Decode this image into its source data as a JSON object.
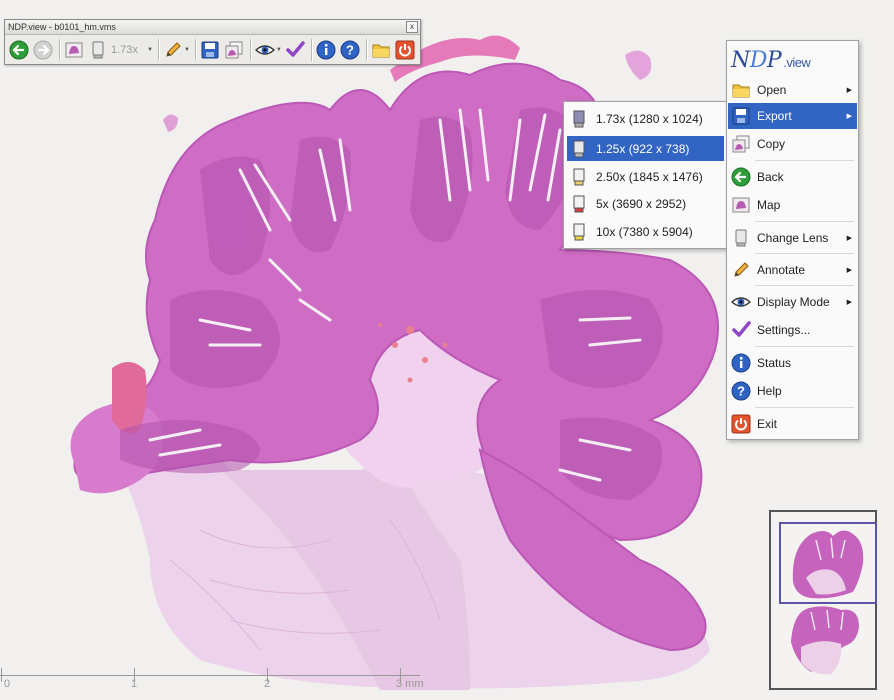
{
  "app": {
    "window_title": "NDP.view - b0101_hm.vms"
  },
  "toolbar": {
    "zoom_label": "1.73x",
    "close_glyph": "x",
    "icons": [
      "back-icon",
      "forward-icon",
      "map-icon",
      "lens-icon",
      "annotate-icon",
      "export-icon",
      "copy-icon",
      "display-mode-icon",
      "settings-icon",
      "status-icon",
      "help-icon",
      "open-icon",
      "exit-icon"
    ]
  },
  "context_menu": {
    "logo": {
      "part1": "N",
      "part2": "D",
      "part3": "P",
      "part4": ".view"
    },
    "items": [
      {
        "label": "Open",
        "icon": "folder-icon",
        "submenu": true
      },
      {
        "label": "Export",
        "icon": "disk-icon",
        "submenu": true,
        "active": true
      },
      {
        "label": "Copy",
        "icon": "copy-icon",
        "submenu": false
      },
      {
        "label": "Back",
        "icon": "back-icon",
        "submenu": false
      },
      {
        "label": "Map",
        "icon": "map-icon",
        "submenu": false
      },
      {
        "label": "Change Lens",
        "icon": "lens-icon",
        "submenu": true
      },
      {
        "label": "Annotate",
        "icon": "pencil-icon",
        "submenu": true
      },
      {
        "label": "Display Mode",
        "icon": "eye-icon",
        "submenu": true
      },
      {
        "label": "Settings...",
        "icon": "checkmark-icon",
        "submenu": false
      },
      {
        "label": "Status",
        "icon": "info-icon",
        "submenu": false
      },
      {
        "label": "Help",
        "icon": "help-icon",
        "submenu": false
      },
      {
        "label": "Exit",
        "icon": "power-icon",
        "submenu": false
      }
    ]
  },
  "export_submenu": {
    "items": [
      {
        "label": "1.73x (1280 x 1024)",
        "lens_color": "#8c8cb4",
        "active": false
      },
      {
        "label": "1.25x (922 x 738)",
        "lens_color": "#d8d8d8",
        "active": true
      },
      {
        "label": "2.50x (1845 x 1476)",
        "lens_color": "#e8d070",
        "active": false
      },
      {
        "label": "5x (3690 x 2952)",
        "lens_color": "#d04040",
        "active": false
      },
      {
        "label": "10x (7380 x 5904)",
        "lens_color": "#e8d84a",
        "active": false
      }
    ]
  },
  "scale_bar": {
    "labels": [
      "0",
      "1",
      "2",
      "3 mm"
    ]
  },
  "colors": {
    "menu_highlight": "#3264c4",
    "tissue": "#cf6cc4",
    "tissue_dark": "#b54fae",
    "stroma": "#e9c4e2"
  }
}
